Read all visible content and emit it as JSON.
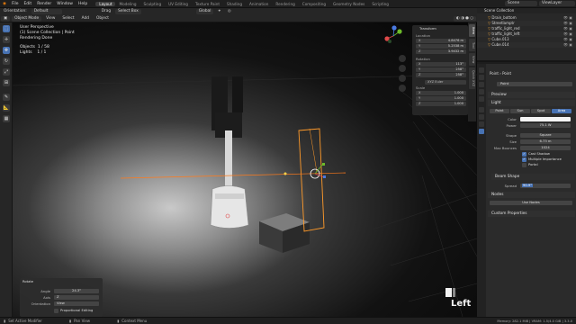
{
  "topbar": {
    "menus": [
      "File",
      "Edit",
      "Render",
      "Window",
      "Help"
    ],
    "workspaces": [
      "Layout",
      "Modeling",
      "Sculpting",
      "UV Editing",
      "Texture Paint",
      "Shading",
      "Animation",
      "Rendering",
      "Compositing",
      "Geometry Nodes",
      "Scripting"
    ],
    "active_workspace": "Layout",
    "scene_label": "Scene",
    "view_layer_label": "ViewLayer"
  },
  "header": {
    "mode": "Object Mode",
    "menus": [
      "View",
      "Select",
      "Add",
      "Object"
    ],
    "orientation_label": "Orientation:",
    "orientation_value": "Default",
    "drag_label": "Drag",
    "drag_value": "Select Box",
    "transform_space": "Global",
    "options_label": "Options"
  },
  "viewport": {
    "view_name": "User Perspective",
    "collection_info": "(1) Scene Collection | Point",
    "status": "Rendering Done",
    "objects_label": "Objects",
    "objects_value": "1 / 58",
    "lights_label": "Lights",
    "lights_value": "1 / 1",
    "key_overlay": "Left",
    "colors": {
      "light_outline": "#ff9a2a",
      "transform_line": "#ff7a1a",
      "axis_x": "#e04a4a",
      "axis_y": "#6cbb2a",
      "axis_z": "#4a7ae0"
    }
  },
  "npanel": {
    "title": "Transform",
    "location_label": "Location",
    "location": [
      {
        "k": "X",
        "v": "4.8476 m"
      },
      {
        "k": "Y",
        "v": "5.2538 m"
      },
      {
        "k": "Z",
        "v": "3.9432 m"
      }
    ],
    "rotation_label": "Rotation",
    "rotation": [
      {
        "k": "X",
        "v": "113°"
      },
      {
        "k": "Y",
        "v": "258°"
      },
      {
        "k": "Z",
        "v": "258°"
      }
    ],
    "rotation_mode": "XYZ Euler",
    "scale_label": "Scale",
    "scale": [
      {
        "k": "X",
        "v": "1.000"
      },
      {
        "k": "Y",
        "v": "1.000"
      },
      {
        "k": "Z",
        "v": "1.000"
      }
    ],
    "tabs": [
      "Item",
      "Tool",
      "View",
      "Quick XYZ"
    ]
  },
  "outliner": {
    "title": "Scene Collection",
    "items": [
      "Drain_bottom",
      "Streetlamptr",
      "traffic_light_red",
      "traffic_light_left",
      "Cube.013",
      "Cube.014"
    ]
  },
  "properties": {
    "breadcrumb": [
      "Point",
      "Point"
    ],
    "datablock_name": "Point",
    "preview_label": "Preview",
    "light_label": "Light",
    "light_types": [
      "Point",
      "Sun",
      "Spot",
      "Area"
    ],
    "active_light_type": "Area",
    "color_label": "Color",
    "power_label": "Power",
    "power_value": "75.1 W",
    "shape_label": "Shape",
    "shape_value": "Square",
    "size_label": "Size",
    "size_value": "6.73 m",
    "max_bounces_label": "Max Bounces",
    "max_bounces_value": "1024",
    "cast_shadow_label": "Cast Shadow",
    "multiple_importance_label": "Multiple Importance",
    "portal_label": "Portal",
    "beam_shape_label": "Beam Shape",
    "spread_label": "Spread",
    "spread_value": "90.9°",
    "nodes_label": "Nodes",
    "use_nodes_label": "Use Nodes",
    "custom_properties_label": "Custom Properties"
  },
  "last_operator": {
    "title": "Rotate",
    "angle_label": "Angle",
    "angle_value": "24.3°",
    "axis_label": "Axis",
    "axis_value": "Z",
    "orientation_label": "Orientation",
    "orientation_value": "View",
    "proportional_label": "Proportional Editing"
  },
  "statusbar": {
    "items": [
      "Set Active Modifier",
      "Pan View",
      "Context Menu"
    ],
    "right": "Memory: 282.1 MiB | VRAM: 1.5/4.0 GiB | 3.3.0"
  }
}
